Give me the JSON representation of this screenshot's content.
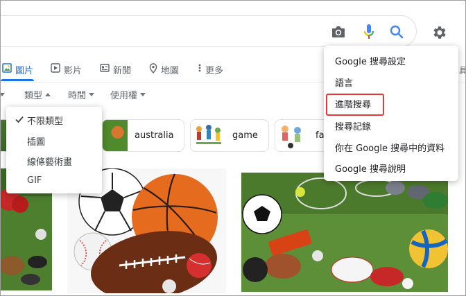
{
  "tabs": [
    {
      "label": "圖片",
      "icon": "image-icon",
      "active": true
    },
    {
      "label": "影片",
      "icon": "play-icon",
      "active": false
    },
    {
      "label": "新聞",
      "icon": "news-icon",
      "active": false
    },
    {
      "label": "地圖",
      "icon": "map-pin-icon",
      "active": false
    },
    {
      "label": "更多",
      "icon": "more-vert-icon",
      "active": false
    }
  ],
  "filters": {
    "type": "類型",
    "time": "時間",
    "usage": "使用權"
  },
  "chips": [
    {
      "label": "australia"
    },
    {
      "label": "game"
    },
    {
      "label": "fa"
    }
  ],
  "type_menu": {
    "selected": "不限類型",
    "options": [
      "不限類型",
      "插圖",
      "線條藝術畫",
      "GIF"
    ]
  },
  "settings_menu": {
    "items": [
      "Google 搜尋設定",
      "語言",
      "進階搜尋",
      "搜尋記錄",
      "你在 Google 搜尋中的資料",
      "Google 搜尋說明"
    ],
    "highlighted_index": 2,
    "highlight_color": "#e53935"
  },
  "colors": {
    "accent": "#1a73e8",
    "mic_blue": "#4285f4",
    "mic_red": "#ea4335",
    "mic_yellow": "#fbbc04",
    "mic_green": "#34a853"
  }
}
